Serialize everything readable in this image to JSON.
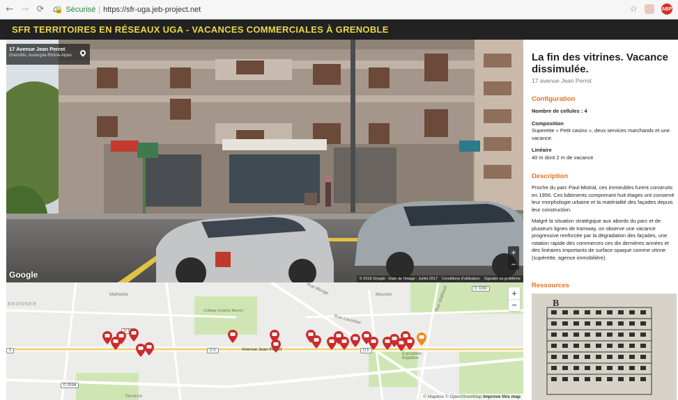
{
  "browser": {
    "secure_label": "Sécurisé",
    "url": "https://sfr-uga.jeb-project.net"
  },
  "site": {
    "title": "SFR TERRITOIRES EN RÉSEAUX UGA - VACANCES COMMERCIALES À GRENOBLE"
  },
  "streetview": {
    "address": "17 Avenue Jean Perrot",
    "region": "Grenoble, Auvergne-Rhône-Alpes",
    "logo": "Google",
    "attribution": "© 2018 Google - Date de l'image : Juillet 2017",
    "terms": "Conditions d'utilisation",
    "report": "Signaler un problème",
    "zoom_in": "+",
    "zoom_out": "−"
  },
  "map": {
    "labels": {
      "bronner": "BRONNER",
      "malherbe": "Malherbe",
      "college": "Collège Charles Munch",
      "avenue": "Avenue Jean Perrot",
      "rue_monge": "Rue Monge",
      "rue_lavoisier": "Rue Lavoisier",
      "exposition": "Exposition Bajatière",
      "rue_malifaud": "Rue Malifaud",
      "mounier": "Mounier",
      "tarronce": "Tarronce",
      "r1090": "D 1090",
      "r269a": "D 269A",
      "r5a": "D 5",
      "r5b": "D 5",
      "r5c": "D 5",
      "r5d": "5"
    },
    "zoom_in": "+",
    "zoom_out": "−",
    "attribution": "© Mapbox © OpenStreetMap",
    "improve": "Improve this map",
    "marker_color": "#cc2b2b",
    "selected_marker_color": "#f08a1c"
  },
  "detail": {
    "title": "La fin des vitrines. Vacance dissimulée.",
    "subtitle": "17 avenue Jean Perrot",
    "config_heading": "Configuration",
    "cells_label": "Nombre de cellules : 4",
    "composition_label": "Composition",
    "composition_text": "Superette « Petit casino », deux services marchands et une vacance.",
    "lineaire_label": "Linéaire",
    "lineaire_text": "40 m dont 2 m de vacance",
    "description_heading": "Description",
    "description_p1": "Proche du parc Paul-Mistral, ces immeubles furent construits en 1956. Ces bâtiments comprenant huit étages ont conservé leur morphologie urbaine et la matérialité des façades depuis leur construction.",
    "description_p2": "Malgré la situation stratégique aux abords du parc et de plusieurs lignes de tramway, on observe une vacance progressive renforcée par la dégradation des façades, une rotation rapide des commerces ces dix dernières années et des linéaires importants de surface opaque comme vitrine (supérette, agence immobilière).",
    "resources_heading": "Ressources",
    "resource_letter": "B"
  },
  "colors": {
    "header_bg": "#222222",
    "header_text": "#e8d84a",
    "accent": "#e9701d"
  }
}
